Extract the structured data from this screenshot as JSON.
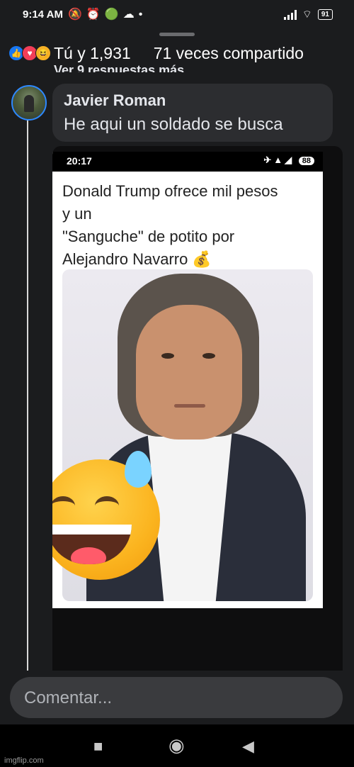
{
  "status_bar": {
    "time": "9:14 AM",
    "battery": "91"
  },
  "post_summary": {
    "reactions_text": "Tú y 1,931",
    "shares_text": "71 veces compartido"
  },
  "comment": {
    "previous_replies_link": "Ver 9 respuestas más...",
    "author": "Javier Roman",
    "text": "He aqui un soldado se busca"
  },
  "attachment": {
    "status_time": "20:17",
    "status_battery": "88",
    "meme_lines": [
      "Donald Trump ofrece mil pesos",
      "y un",
      "\"Sanguche\" de potito por",
      "Alejandro Navarro 💰"
    ]
  },
  "composer": {
    "placeholder": "Comentar..."
  },
  "watermark": "imgflip.com"
}
